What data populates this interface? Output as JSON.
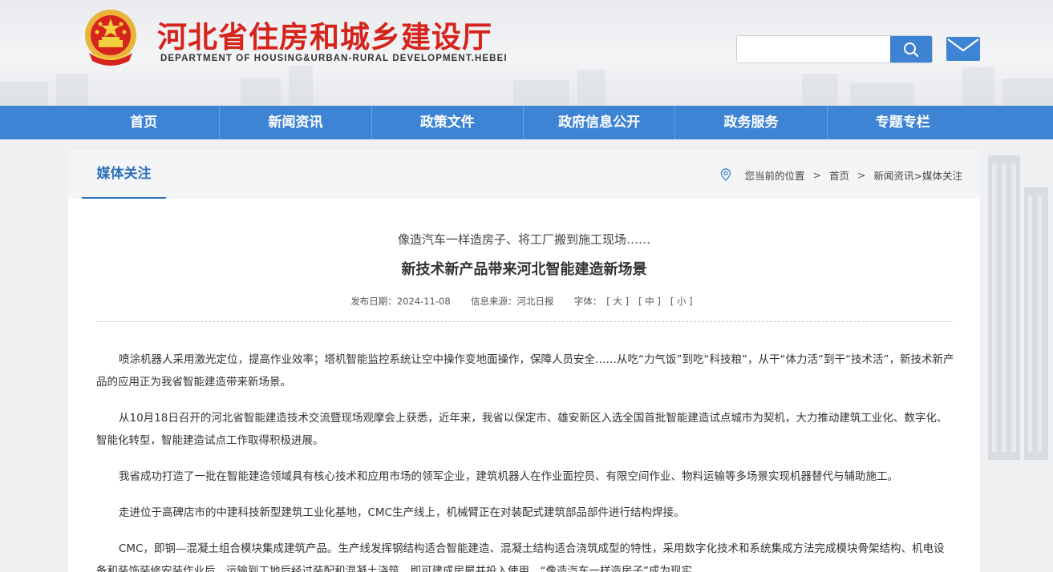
{
  "header": {
    "site_title": "河北省住房和城乡建设厅",
    "site_subtitle": "DEPARTMENT OF HOUSING&URBAN-RURAL DEVELOPMENT.HEBEI",
    "emblem_icon": "national-emblem-icon",
    "search_placeholder": "",
    "search_icon": "search-icon",
    "mail_icon": "mail-icon"
  },
  "nav": {
    "items": [
      "首页",
      "新闻资讯",
      "政策文件",
      "政府信息公开",
      "政务服务",
      "专题专栏"
    ]
  },
  "section": {
    "tab_label": "媒体关注"
  },
  "breadcrumb": {
    "prefix": "您当前的位置",
    "home": "首页",
    "current": "新闻资讯>媒体关注"
  },
  "article": {
    "pre_title": "像造汽车一样造房子、将工厂搬到施工现场……",
    "title": "新技术新产品带来河北智能建造新场景",
    "date_label": "发布日期：",
    "date": "2024-11-08",
    "source_label": "信息来源：",
    "source": "河北日报",
    "font_label": "字体：",
    "font_large": "[ 大 ]",
    "font_medium": "[ 中 ]",
    "font_small": "[ 小 ]",
    "paragraphs": [
      "喷涂机器人采用激光定位，提高作业效率；塔机智能监控系统让空中操作变地面操作，保障人员安全……从吃“力气饭”到吃“科技粮”，从干“体力活”到干“技术活”，新技术新产品的应用正为我省智能建造带来新场景。",
      "从10月18日召开的河北省智能建造技术交流暨现场观摩会上获悉，近年来，我省以保定市、雄安新区入选全国首批智能建造试点城市为契机，大力推动建筑工业化、数字化、智能化转型，智能建造试点工作取得积极进展。",
      "我省成功打造了一批在智能建造领域具有核心技术和应用市场的领军企业，建筑机器人在作业面控员、有限空间作业、物料运输等多场景实现机器替代与辅助施工。",
      "走进位于高碑店市的中建科技新型建筑工业化基地，CMC生产线上，机械臂正在对装配式建筑部品部件进行结构焊接。",
      "CMC，即钢—混凝土组合模块集成建筑产品。生产线发挥钢结构适合智能建造、混凝土结构适合浇筑成型的特性，采用数字化技术和系统集成方法完成模块骨架结构、机电设备和装饰装修安装作业后，运输到工地后经过装配和混凝土浇筑，即可建成房屋并投入使用，“像造汽车一样造房子”成为现实。"
    ]
  },
  "colors": {
    "brand_red": "#d6241c",
    "nav_blue": "#3d84d5",
    "accent_blue": "#2c6fba"
  }
}
